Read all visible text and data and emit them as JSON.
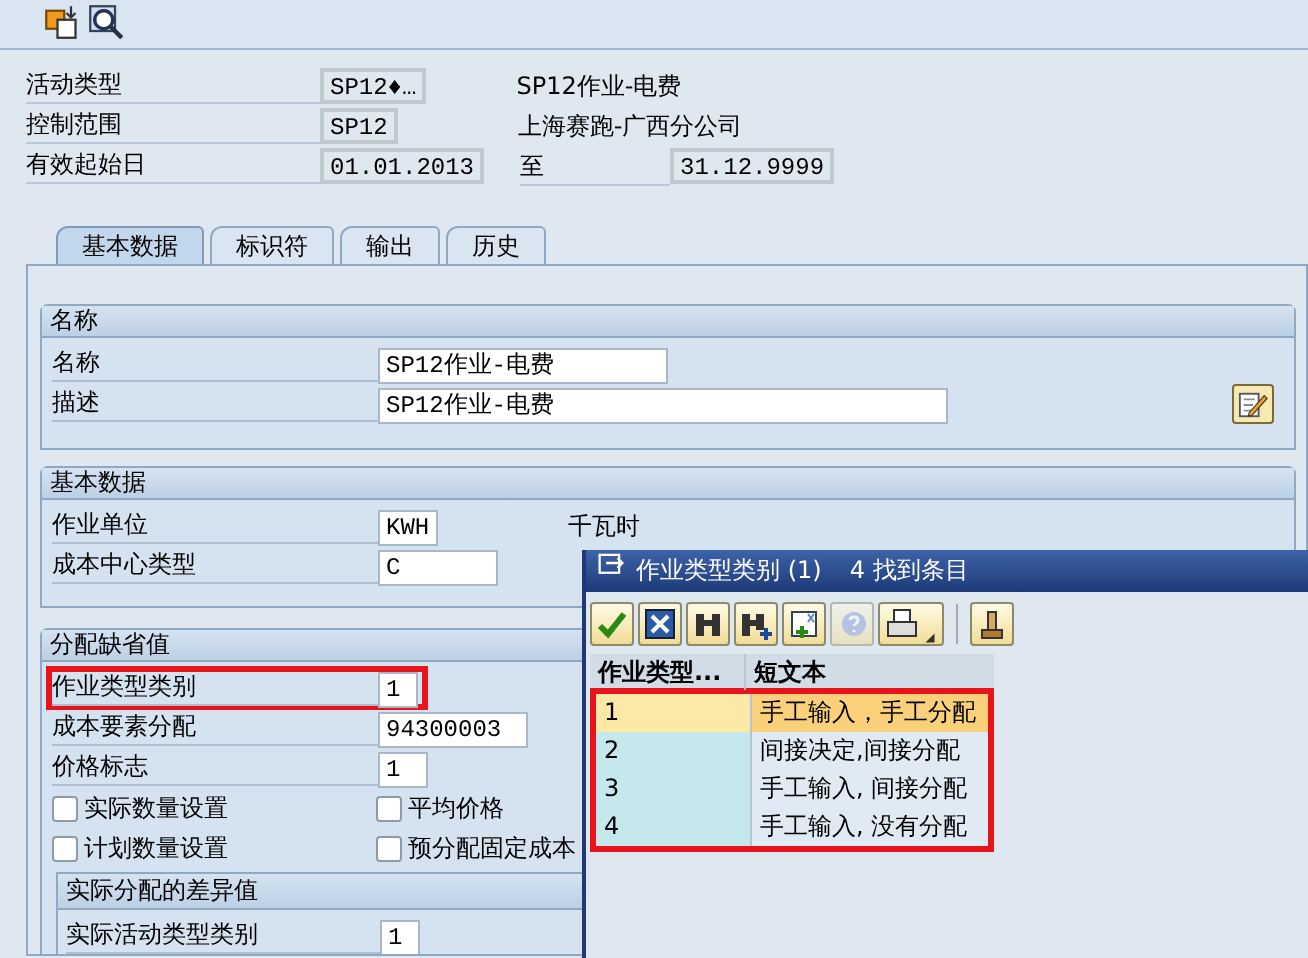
{
  "toolbar": [
    {
      "kind": "switch"
    },
    {
      "kind": "search"
    }
  ],
  "header": [
    {
      "label": "活动类型",
      "value": "SP12♦…",
      "description": "SP12作业-电费"
    },
    {
      "label": "控制范围",
      "value": "SP12",
      "description": "上海赛跑-广西分公司"
    },
    {
      "label": "有效起始日",
      "value": "01.01.2013",
      "to_label": "至",
      "to_value": "31.12.9999"
    }
  ],
  "tabs": [
    {
      "label": "基本数据",
      "selected": true
    },
    {
      "label": "标识符",
      "selected": false
    },
    {
      "label": "输出",
      "selected": false
    },
    {
      "label": "历史",
      "selected": false
    }
  ],
  "groups": [
    {
      "title": "名称",
      "edit_button": true,
      "rows": [
        {
          "kind": "field",
          "label": "名称",
          "value": "SP12作业-电费"
        },
        {
          "kind": "field",
          "label": "描述",
          "value": "SP12作业-电费"
        }
      ]
    },
    {
      "title": "基本数据",
      "rows": [
        {
          "kind": "field",
          "label": "作业单位",
          "value": "KWH",
          "side_text": "千瓦时"
        },
        {
          "kind": "field",
          "label": "成本中心类型",
          "value": "C"
        }
      ]
    },
    {
      "title": "分配缺省值",
      "rows": [
        {
          "kind": "field",
          "label": "作业类型类别",
          "value": "1",
          "highlighted": true
        },
        {
          "kind": "field",
          "label": "成本要素分配",
          "value": "94300003"
        },
        {
          "kind": "field",
          "label": "价格标志",
          "value": "1"
        },
        {
          "kind": "checks",
          "items": [
            {
              "label": "实际数量设置",
              "checked": false
            },
            {
              "label": "平均价格",
              "checked": false
            }
          ]
        },
        {
          "kind": "checks",
          "items": [
            {
              "label": "计划数量设置",
              "checked": false
            },
            {
              "label": "预分配固定成本",
              "checked": false
            }
          ]
        },
        {
          "kind": "subgroup",
          "title": "实际分配的差异值",
          "rows": [
            {
              "kind": "field",
              "label": "实际活动类型类别",
              "value": "1"
            }
          ]
        }
      ]
    }
  ],
  "popup": {
    "title": "作业类型类别 (1)",
    "count": "4 找到条目",
    "toolbar": [
      {
        "kind": "confirm"
      },
      {
        "kind": "cancel"
      },
      {
        "kind": "find"
      },
      {
        "kind": "find-next"
      },
      {
        "kind": "new"
      },
      {
        "kind": "help"
      },
      {
        "kind": "print"
      },
      {
        "kind": "separator"
      },
      {
        "kind": "stamp"
      }
    ],
    "columns": [
      "作业类型...",
      "短文本"
    ],
    "highlighted": true,
    "rows": [
      {
        "cells": [
          "1",
          "手工输入，手工分配"
        ],
        "selected": true
      },
      {
        "cells": [
          "2",
          "间接决定,间接分配"
        ],
        "selected": false
      },
      {
        "cells": [
          "3",
          "手工输入, 间接分配"
        ],
        "selected": false
      },
      {
        "cells": [
          "4",
          "手工输入, 没有分配"
        ],
        "selected": false
      }
    ]
  }
}
